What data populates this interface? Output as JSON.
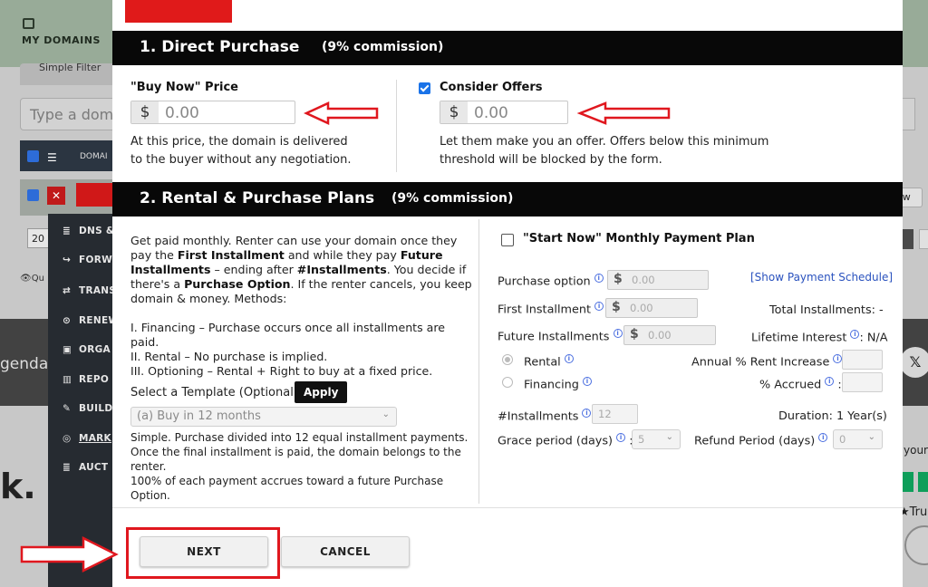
{
  "background": {
    "my_domains_label": "MY DOMAINS",
    "simple_filter_label": "Simple Filter",
    "search_placeholder": "Type a dom",
    "table_header_label": "DOMAI",
    "row_year_value": "20",
    "quick_label": "Qu",
    "agenda_text": "genda",
    "x_logo": "𝕏",
    "your_text": "your",
    "k_text": "k.",
    "trust_text": "Tru",
    "view_button": "ew"
  },
  "side_menu": {
    "items": [
      {
        "label": "DNS &",
        "icon": "≣"
      },
      {
        "label": "FORW",
        "icon": "↪"
      },
      {
        "label": "TRANS",
        "icon": "⇄"
      },
      {
        "label": "RENEW",
        "icon": "⊙"
      },
      {
        "label": "ORGA",
        "icon": "▣"
      },
      {
        "label": "REPO",
        "icon": "▥"
      },
      {
        "label": "BUILD",
        "icon": "✎"
      },
      {
        "label": "MARK",
        "icon": "◎"
      },
      {
        "label": "AUCT",
        "icon": "≣"
      }
    ]
  },
  "section1": {
    "title": "1. Direct Purchase",
    "commission": "(9% commission)",
    "buy_now_label": "\"Buy Now\" Price",
    "buy_now_currency": "$",
    "buy_now_value": "0.00",
    "buy_now_desc_line1": "At this price, the domain is delivered",
    "buy_now_desc_line2": "to the buyer without any negotiation.",
    "consider_offers_label": "Consider Offers",
    "consider_offers_checked": true,
    "offers_currency": "$",
    "offers_value": "0.00",
    "offers_desc_line1": "Let them make you an offer. Offers below this minimum",
    "offers_desc_line2": "threshold will be blocked by the form."
  },
  "section2": {
    "title": "2. Rental & Purchase Plans",
    "commission": "(9% commission)",
    "desc_p1_a": "Get paid monthly. Renter can use your domain once they pay the ",
    "desc_p1_b": "First Installment",
    "desc_p1_c": " and while they pay ",
    "desc_p1_d": "Future Installments",
    "desc_p1_e": " – ending after ",
    "desc_p1_f": "#Installments",
    "desc_p1_g": ". You decide if there's a ",
    "desc_p1_h": "Purchase Option",
    "desc_p1_i": ". If the renter cancels, you keep domain & money. Methods:",
    "method_1": "I. Financing – Purchase occurs once all installments are paid.",
    "method_2": "II. Rental – No purchase is implied.",
    "method_3": "III. Optioning – Rental + Right to buy at a fixed price.",
    "template_label": "Select a Template (Optional):",
    "apply_button": "Apply",
    "template_selected": "(a) Buy in 12 months",
    "template_desc_1": "Simple. Purchase divided into 12 equal installment payments.",
    "template_desc_2": "Once the final installment is paid, the domain belongs to the renter.",
    "template_desc_3": "100% of each payment accrues toward a future Purchase Option.",
    "start_now_label": "\"Start Now\" Monthly Payment Plan",
    "purchase_option_label": "Purchase option",
    "purchase_option_currency": "$",
    "purchase_option_placeholder": "0.00",
    "show_schedule_link": "[Show Payment Schedule]",
    "first_installment_label": "First Installment",
    "first_installment_currency": "$",
    "first_installment_placeholder": "0.00",
    "total_installments": "Total Installments: -",
    "future_installments_label": "Future Installments",
    "future_installments_currency": "$",
    "future_installments_placeholder": "0.00",
    "lifetime_interest_label": "Lifetime Interest",
    "lifetime_interest_value": ": N/A",
    "rental_label": "Rental",
    "financing_label": "Financing",
    "annual_rent_label": "Annual % Rent Increase",
    "accrued_label": "% Accrued",
    "installments_label": "#Installments",
    "installments_value": "12",
    "duration_text": "Duration: 1 Year(s)",
    "grace_label": "Grace period (days)",
    "grace_value": "5",
    "refund_label": "Refund Period (days)",
    "refund_value": "0",
    "colon": ":"
  },
  "footer": {
    "next_button": "NEXT",
    "cancel_button": "CANCEL"
  },
  "colors": {
    "annotation_red": "#e0171e",
    "header_black": "#080808",
    "checkbox_blue": "#1a73e8",
    "link_blue": "#2a52be"
  }
}
